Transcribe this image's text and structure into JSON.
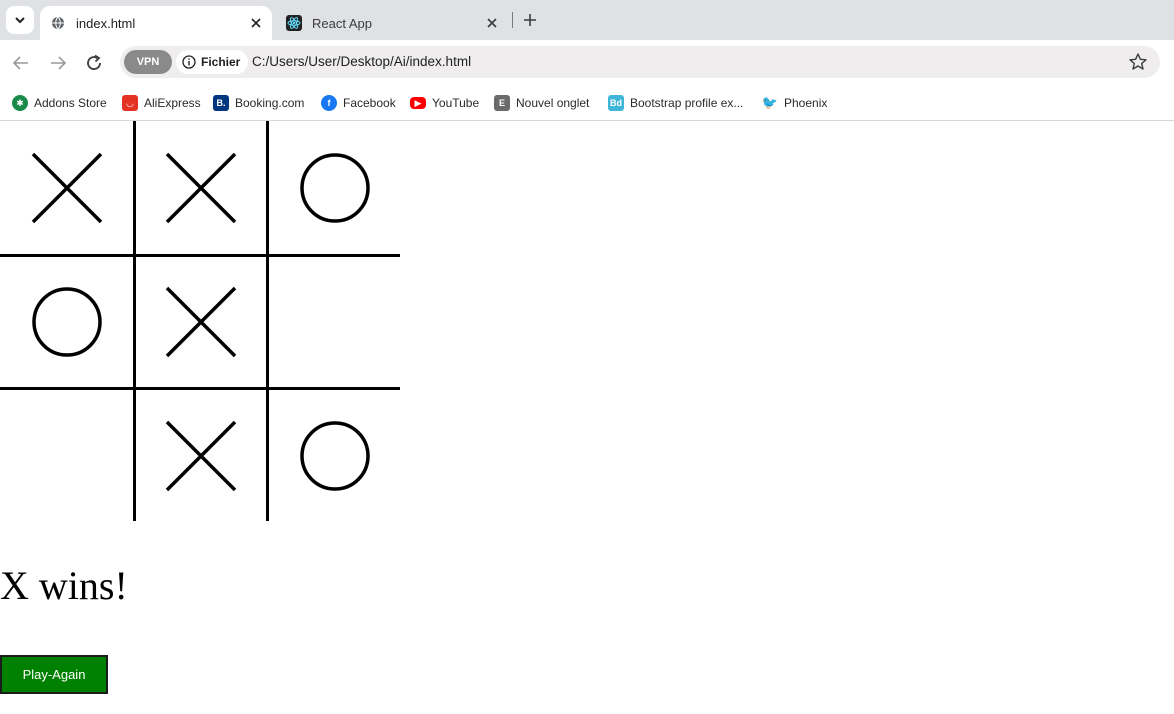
{
  "tabs": [
    {
      "title": "index.html",
      "icon": "globe-icon",
      "active": true
    },
    {
      "title": "React App",
      "icon": "react-icon",
      "active": false
    }
  ],
  "toolbar": {
    "vpn_label": "VPN",
    "site_chip": "Fichier",
    "url": "C:/Users/User/Desktop/Ai/index.html"
  },
  "bookmarks": [
    {
      "label": "Addons Store",
      "icon": "addons-store-icon",
      "color": "#1a8a4a"
    },
    {
      "label": "AliExpress",
      "icon": "aliexpress-icon",
      "color": "#e43225"
    },
    {
      "label": "Booking.com",
      "icon": "booking-icon",
      "color": "#003580"
    },
    {
      "label": "Facebook",
      "icon": "facebook-icon",
      "color": "#1877f2"
    },
    {
      "label": "YouTube",
      "icon": "youtube-icon",
      "color": "#ff0000"
    },
    {
      "label": "Nouvel onglet",
      "icon": "new-tab-icon",
      "color": "#6b6b6b"
    },
    {
      "label": "Bootstrap profile ex...",
      "icon": "bootstrap-icon",
      "color": "#3fb6d9"
    },
    {
      "label": "Phoenix",
      "icon": "phoenix-icon",
      "color": "#f07a2e"
    }
  ],
  "game": {
    "board": [
      "X",
      "X",
      "O",
      "O",
      "X",
      "",
      "",
      "X",
      "O"
    ],
    "status": "X wins!",
    "play_again_label": "Play-Again",
    "button_color": "#008000"
  }
}
